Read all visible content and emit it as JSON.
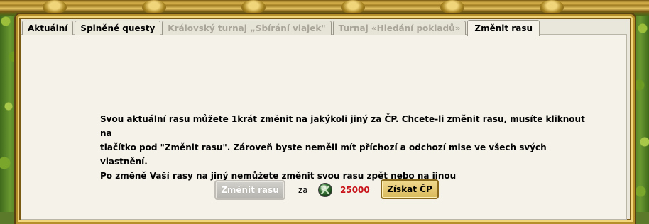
{
  "tabs": [
    {
      "label": "Aktuální",
      "state": "normal"
    },
    {
      "label": "Splněné questy",
      "state": "normal"
    },
    {
      "label": "Královský turnaj „Sbírání vlajek\"",
      "state": "disabled"
    },
    {
      "label": "Turnaj «Hledání pokladů»",
      "state": "disabled"
    },
    {
      "label": "Změnit rasu",
      "state": "active"
    }
  ],
  "message": {
    "line1": "Svou aktuální rasu můžete 1krát změnit na jakýkoli jiný za ČP. Chcete-li změnit rasu, musíte kliknout na",
    "line2": "tlačítko pod \"Změnit rasu\". Zároveň byste neměli mít příchozí a odchozí mise ve všech svých vlastnění.",
    "line3": "Po změně Vaší rasy na jiný nemůžete změnit svou rasu zpět nebo na jinou"
  },
  "actions": {
    "change_button": "Změnit rasu",
    "za": "za",
    "currency_icon": "cp-coin-icon",
    "price": "25000",
    "get_cp_button": "Získat ČP"
  },
  "colors": {
    "price": "#c8141a",
    "frame_gold": "#b58f2a"
  }
}
